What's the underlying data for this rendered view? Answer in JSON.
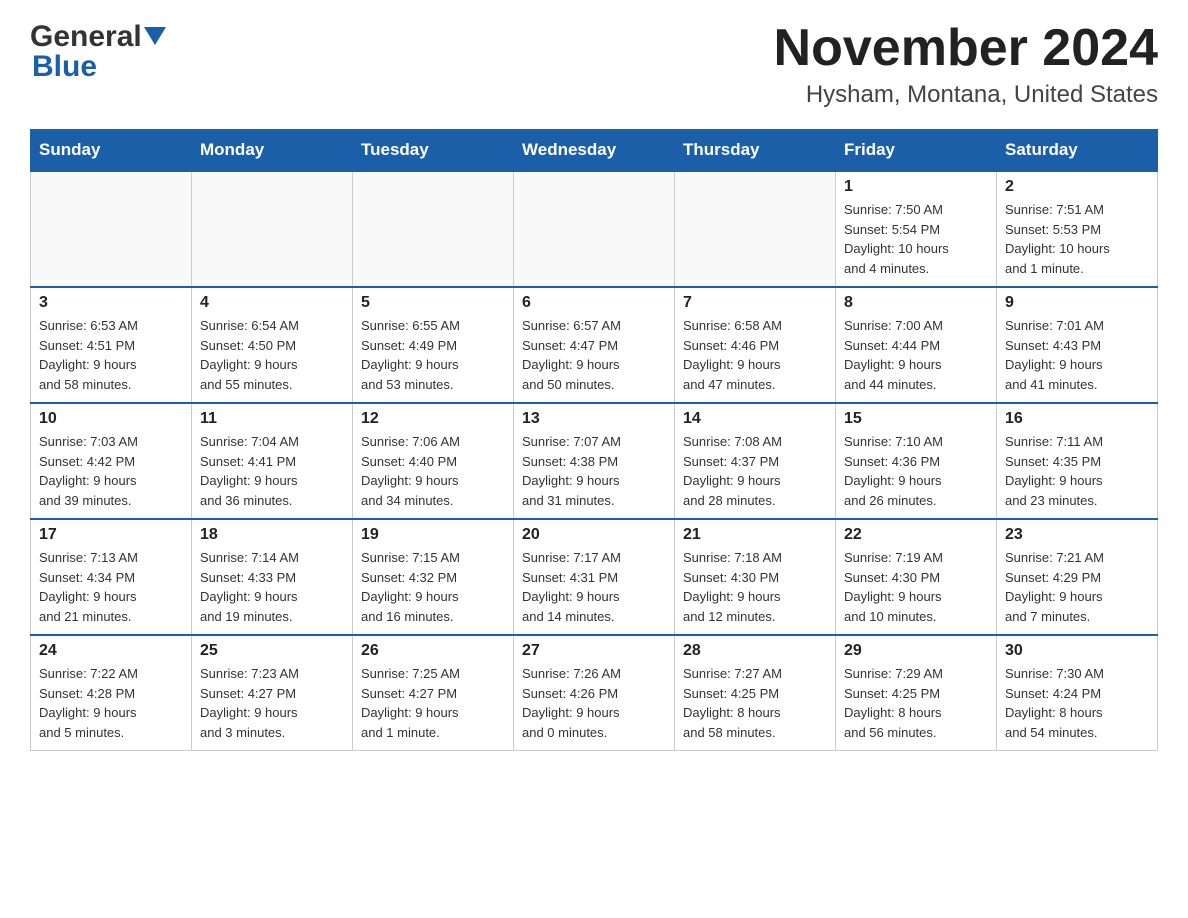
{
  "header": {
    "logo_general": "General",
    "logo_blue": "Blue",
    "title": "November 2024",
    "subtitle": "Hysham, Montana, United States"
  },
  "days_of_week": [
    "Sunday",
    "Monday",
    "Tuesday",
    "Wednesday",
    "Thursday",
    "Friday",
    "Saturday"
  ],
  "weeks": [
    [
      {
        "day": "",
        "info": ""
      },
      {
        "day": "",
        "info": ""
      },
      {
        "day": "",
        "info": ""
      },
      {
        "day": "",
        "info": ""
      },
      {
        "day": "",
        "info": ""
      },
      {
        "day": "1",
        "info": "Sunrise: 7:50 AM\nSunset: 5:54 PM\nDaylight: 10 hours\nand 4 minutes."
      },
      {
        "day": "2",
        "info": "Sunrise: 7:51 AM\nSunset: 5:53 PM\nDaylight: 10 hours\nand 1 minute."
      }
    ],
    [
      {
        "day": "3",
        "info": "Sunrise: 6:53 AM\nSunset: 4:51 PM\nDaylight: 9 hours\nand 58 minutes."
      },
      {
        "day": "4",
        "info": "Sunrise: 6:54 AM\nSunset: 4:50 PM\nDaylight: 9 hours\nand 55 minutes."
      },
      {
        "day": "5",
        "info": "Sunrise: 6:55 AM\nSunset: 4:49 PM\nDaylight: 9 hours\nand 53 minutes."
      },
      {
        "day": "6",
        "info": "Sunrise: 6:57 AM\nSunset: 4:47 PM\nDaylight: 9 hours\nand 50 minutes."
      },
      {
        "day": "7",
        "info": "Sunrise: 6:58 AM\nSunset: 4:46 PM\nDaylight: 9 hours\nand 47 minutes."
      },
      {
        "day": "8",
        "info": "Sunrise: 7:00 AM\nSunset: 4:44 PM\nDaylight: 9 hours\nand 44 minutes."
      },
      {
        "day": "9",
        "info": "Sunrise: 7:01 AM\nSunset: 4:43 PM\nDaylight: 9 hours\nand 41 minutes."
      }
    ],
    [
      {
        "day": "10",
        "info": "Sunrise: 7:03 AM\nSunset: 4:42 PM\nDaylight: 9 hours\nand 39 minutes."
      },
      {
        "day": "11",
        "info": "Sunrise: 7:04 AM\nSunset: 4:41 PM\nDaylight: 9 hours\nand 36 minutes."
      },
      {
        "day": "12",
        "info": "Sunrise: 7:06 AM\nSunset: 4:40 PM\nDaylight: 9 hours\nand 34 minutes."
      },
      {
        "day": "13",
        "info": "Sunrise: 7:07 AM\nSunset: 4:38 PM\nDaylight: 9 hours\nand 31 minutes."
      },
      {
        "day": "14",
        "info": "Sunrise: 7:08 AM\nSunset: 4:37 PM\nDaylight: 9 hours\nand 28 minutes."
      },
      {
        "day": "15",
        "info": "Sunrise: 7:10 AM\nSunset: 4:36 PM\nDaylight: 9 hours\nand 26 minutes."
      },
      {
        "day": "16",
        "info": "Sunrise: 7:11 AM\nSunset: 4:35 PM\nDaylight: 9 hours\nand 23 minutes."
      }
    ],
    [
      {
        "day": "17",
        "info": "Sunrise: 7:13 AM\nSunset: 4:34 PM\nDaylight: 9 hours\nand 21 minutes."
      },
      {
        "day": "18",
        "info": "Sunrise: 7:14 AM\nSunset: 4:33 PM\nDaylight: 9 hours\nand 19 minutes."
      },
      {
        "day": "19",
        "info": "Sunrise: 7:15 AM\nSunset: 4:32 PM\nDaylight: 9 hours\nand 16 minutes."
      },
      {
        "day": "20",
        "info": "Sunrise: 7:17 AM\nSunset: 4:31 PM\nDaylight: 9 hours\nand 14 minutes."
      },
      {
        "day": "21",
        "info": "Sunrise: 7:18 AM\nSunset: 4:30 PM\nDaylight: 9 hours\nand 12 minutes."
      },
      {
        "day": "22",
        "info": "Sunrise: 7:19 AM\nSunset: 4:30 PM\nDaylight: 9 hours\nand 10 minutes."
      },
      {
        "day": "23",
        "info": "Sunrise: 7:21 AM\nSunset: 4:29 PM\nDaylight: 9 hours\nand 7 minutes."
      }
    ],
    [
      {
        "day": "24",
        "info": "Sunrise: 7:22 AM\nSunset: 4:28 PM\nDaylight: 9 hours\nand 5 minutes."
      },
      {
        "day": "25",
        "info": "Sunrise: 7:23 AM\nSunset: 4:27 PM\nDaylight: 9 hours\nand 3 minutes."
      },
      {
        "day": "26",
        "info": "Sunrise: 7:25 AM\nSunset: 4:27 PM\nDaylight: 9 hours\nand 1 minute."
      },
      {
        "day": "27",
        "info": "Sunrise: 7:26 AM\nSunset: 4:26 PM\nDaylight: 9 hours\nand 0 minutes."
      },
      {
        "day": "28",
        "info": "Sunrise: 7:27 AM\nSunset: 4:25 PM\nDaylight: 8 hours\nand 58 minutes."
      },
      {
        "day": "29",
        "info": "Sunrise: 7:29 AM\nSunset: 4:25 PM\nDaylight: 8 hours\nand 56 minutes."
      },
      {
        "day": "30",
        "info": "Sunrise: 7:30 AM\nSunset: 4:24 PM\nDaylight: 8 hours\nand 54 minutes."
      }
    ]
  ]
}
